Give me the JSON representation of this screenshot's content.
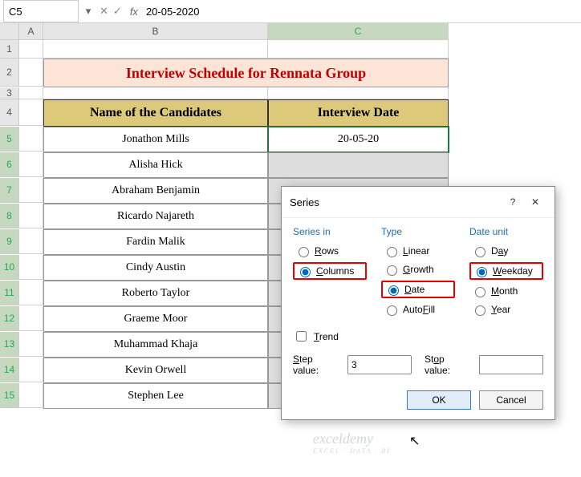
{
  "namebox": {
    "ref": "C5"
  },
  "formula_bar": {
    "fx_label": "fx",
    "value": "20-05-2020"
  },
  "columns": [
    "A",
    "B",
    "C"
  ],
  "rows": [
    "1",
    "2",
    "3",
    "4",
    "5",
    "6",
    "7",
    "8",
    "9",
    "10",
    "11",
    "12",
    "13",
    "14",
    "15"
  ],
  "title": "Interview Schedule for Rennata Group",
  "headers": {
    "b": "Name of the Candidates",
    "c": "Interview Date"
  },
  "candidates": [
    "Jonathon Mills",
    "Alisha Hick",
    "Abraham Benjamin",
    "Ricardo Najareth",
    "Fardin Malik",
    "Cindy Austin",
    "Roberto Taylor",
    "Graeme Moor",
    "Muhammad Khaja",
    "Kevin Orwell",
    "Stephen Lee"
  ],
  "interview_date": "20-05-20",
  "dialog": {
    "title": "Series",
    "groups": {
      "series_in": {
        "label": "Series in",
        "rows": "Rows",
        "columns": "Columns"
      },
      "type": {
        "label": "Type",
        "linear": "Linear",
        "growth": "Growth",
        "date": "Date",
        "autofill": "AutoFill"
      },
      "date_unit": {
        "label": "Date unit",
        "day": "Day",
        "weekday": "Weekday",
        "month": "Month",
        "year": "Year"
      }
    },
    "trend": "Trend",
    "step_label": "Step value:",
    "step_value": "3",
    "stop_label": "Stop value:",
    "stop_value": "",
    "ok": "OK",
    "cancel": "Cancel"
  },
  "watermark": {
    "main": "exceldemy",
    "sub": "EXCEL · DATA · BI"
  }
}
